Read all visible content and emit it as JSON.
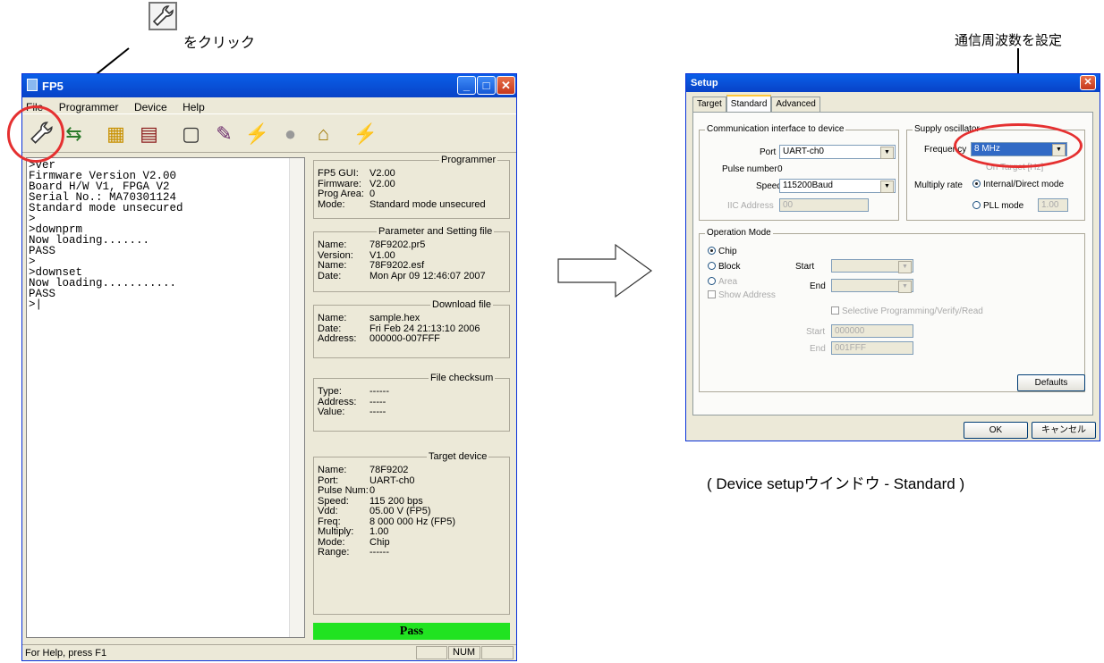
{
  "annotations": {
    "click_text": "をクリック",
    "freq_note": "通信周波数を設定",
    "caption": "( Device setupウインドウ - Standard )"
  },
  "fp5": {
    "title": "FP5",
    "menu": [
      "File",
      "Programmer",
      "Device",
      "Help"
    ],
    "toolbar": [
      "setup-icon",
      "connect-icon",
      "chip-icon",
      "hex-file-icon",
      "blank-icon",
      "erase-icon",
      "program-icon",
      "traffic-light-icon",
      "security-icon",
      "auto-icon"
    ],
    "console": ">ver\nFirmware Version V2.00\nBoard H/W V1, FPGA V2\nSerial No.: MA70301124\nStandard mode unsecured\n>\n>downprm\nNow loading.......\nPASS\n>\n>downset\nNow loading...........\nPASS\n>|",
    "programmer": {
      "title": "Programmer",
      "rows": [
        [
          "FP5 GUI:",
          "V2.00"
        ],
        [
          "Firmware:",
          "V2.00"
        ],
        [
          "Prog Area:",
          "0"
        ],
        [
          "Mode:",
          "Standard mode unsecured"
        ]
      ]
    },
    "param": {
      "title": "Parameter and Setting file",
      "rows": [
        [
          "Name:",
          "78F9202.pr5"
        ],
        [
          "Version:",
          "V1.00"
        ],
        [
          "Name:",
          "78F9202.esf"
        ],
        [
          "Date:",
          "Mon Apr 09 12:46:07 2007"
        ]
      ]
    },
    "download": {
      "title": "Download file",
      "rows": [
        [
          "Name:",
          "sample.hex"
        ],
        [
          "Date:",
          "Fri Feb 24 21:13:10 2006"
        ],
        [
          "Address:",
          "000000-007FFF"
        ]
      ]
    },
    "checksum": {
      "title": "File checksum",
      "rows": [
        [
          "Type:",
          "------"
        ],
        [
          "Address:",
          "-----"
        ],
        [
          "Value:",
          "-----"
        ]
      ]
    },
    "target": {
      "title": "Target device",
      "rows": [
        [
          "Name:",
          "78F9202"
        ],
        [
          "Port:",
          "UART-ch0"
        ],
        [
          "Pulse Num:",
          "0"
        ],
        [
          "Speed:",
          "115 200 bps"
        ],
        [
          "Vdd:",
          "05.00 V (FP5)"
        ],
        [
          "Freq:",
          "8 000 000 Hz (FP5)"
        ],
        [
          "Multiply:",
          "1.00"
        ],
        [
          "Mode:",
          "Chip"
        ],
        [
          "Range:",
          "------"
        ]
      ]
    },
    "pass": "Pass",
    "status": "For Help, press F1",
    "num": "NUM"
  },
  "setup": {
    "title": "Setup",
    "tabs": [
      "Target",
      "Standard",
      "Advanced"
    ],
    "comm": {
      "title": "Communication interface to device",
      "port_label": "Port",
      "port_value": "UART-ch0",
      "pulse_label": "Pulse number",
      "pulse_value": "0",
      "speed_label": "Speed",
      "speed_value": "115200Baud",
      "iic_label": "IIC Address",
      "iic_value": "00"
    },
    "osc": {
      "title": "Supply oscillator",
      "freq_label": "Frequency",
      "freq_value": "8 MHz",
      "on_target": "On Target [Hz]",
      "multiply_label": "Multiply rate",
      "internal": "Internal/Direct mode",
      "pll": "PLL mode",
      "pll_value": "1.00"
    },
    "op": {
      "title": "Operation Mode",
      "chip": "Chip",
      "block": "Block",
      "area": "Area",
      "show_address": "Show Address",
      "start": "Start",
      "end": "End",
      "selective": "Selective Programming/Verify/Read",
      "start2": "Start",
      "start2_value": "000000",
      "end2": "End",
      "end2_value": "001FFF"
    },
    "defaults": "Defaults",
    "ok": "OK",
    "cancel": "キャンセル"
  }
}
